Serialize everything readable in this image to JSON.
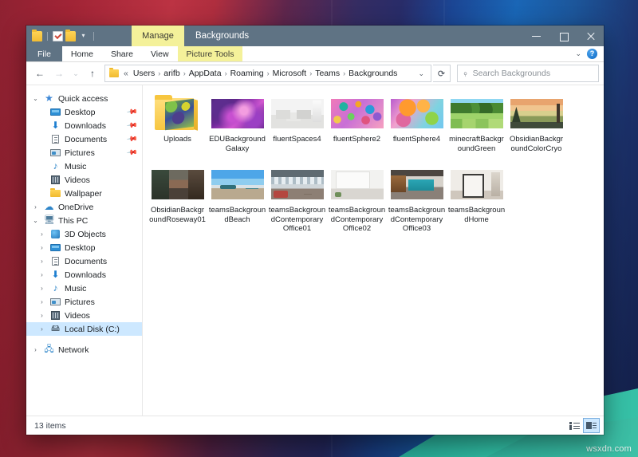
{
  "window": {
    "title": "Backgrounds",
    "contextual_tab_group": "Manage",
    "minimize_label": "Minimize",
    "maximize_label": "Maximize",
    "close_label": "Close"
  },
  "quick_access_toolbar": {
    "items": [
      {
        "name": "folder-icon",
        "label": "Properties Folder"
      },
      {
        "name": "properties-icon",
        "label": "Properties"
      },
      {
        "name": "new-folder-icon",
        "label": "New folder"
      }
    ],
    "customize_label": "Customize Quick Access Toolbar"
  },
  "ribbon": {
    "tabs": [
      {
        "label": "File",
        "kind": "file"
      },
      {
        "label": "Home",
        "kind": "normal"
      },
      {
        "label": "Share",
        "kind": "normal"
      },
      {
        "label": "View",
        "kind": "normal"
      },
      {
        "label": "Picture Tools",
        "kind": "contextual"
      }
    ],
    "collapse_label": "Collapse the Ribbon",
    "help_label": "?"
  },
  "address_bar": {
    "back_label": "Back",
    "forward_label": "Forward",
    "recent_label": "Recent locations",
    "up_label": "Up",
    "overflow": "«",
    "crumbs": [
      "Users",
      "arifb",
      "AppData",
      "Roaming",
      "Microsoft",
      "Teams",
      "Backgrounds"
    ],
    "separator": "›",
    "dropdown_label": "Previous locations",
    "refresh_label": "Refresh"
  },
  "search": {
    "placeholder": "Search Backgrounds",
    "icon": "search-icon"
  },
  "sidebar": {
    "items": [
      {
        "label": "Quick access",
        "icon": "star-icon",
        "twisty": "⌄",
        "indent": 0,
        "pinned": false,
        "selected": false
      },
      {
        "label": "Desktop",
        "icon": "desktop-icon",
        "twisty": "",
        "indent": 1,
        "pinned": true,
        "selected": false
      },
      {
        "label": "Downloads",
        "icon": "download-icon",
        "twisty": "",
        "indent": 1,
        "pinned": true,
        "selected": false
      },
      {
        "label": "Documents",
        "icon": "document-icon",
        "twisty": "",
        "indent": 1,
        "pinned": true,
        "selected": false
      },
      {
        "label": "Pictures",
        "icon": "pictures-icon",
        "twisty": "",
        "indent": 1,
        "pinned": true,
        "selected": false
      },
      {
        "label": "Music",
        "icon": "music-icon",
        "twisty": "",
        "indent": 1,
        "pinned": false,
        "selected": false
      },
      {
        "label": "Videos",
        "icon": "video-icon",
        "twisty": "",
        "indent": 1,
        "pinned": false,
        "selected": false
      },
      {
        "label": "Wallpaper",
        "icon": "folder-icon",
        "twisty": "",
        "indent": 1,
        "pinned": false,
        "selected": false
      },
      {
        "label": "OneDrive",
        "icon": "cloud-icon",
        "twisty": "›",
        "indent": 0,
        "pinned": false,
        "selected": false
      },
      {
        "label": "This PC",
        "icon": "pc-icon",
        "twisty": "⌄",
        "indent": 0,
        "pinned": false,
        "selected": false
      },
      {
        "label": "3D Objects",
        "icon": "cube-icon",
        "twisty": "›",
        "indent": 1,
        "pinned": false,
        "selected": false
      },
      {
        "label": "Desktop",
        "icon": "desktop-icon",
        "twisty": "›",
        "indent": 1,
        "pinned": false,
        "selected": false
      },
      {
        "label": "Documents",
        "icon": "document-icon",
        "twisty": "›",
        "indent": 1,
        "pinned": false,
        "selected": false
      },
      {
        "label": "Downloads",
        "icon": "download-icon",
        "twisty": "›",
        "indent": 1,
        "pinned": false,
        "selected": false
      },
      {
        "label": "Music",
        "icon": "music-icon",
        "twisty": "›",
        "indent": 1,
        "pinned": false,
        "selected": false
      },
      {
        "label": "Pictures",
        "icon": "pictures-icon",
        "twisty": "›",
        "indent": 1,
        "pinned": false,
        "selected": false
      },
      {
        "label": "Videos",
        "icon": "video-icon",
        "twisty": "›",
        "indent": 1,
        "pinned": false,
        "selected": false
      },
      {
        "label": "Local Disk (C:)",
        "icon": "disk-icon",
        "twisty": "›",
        "indent": 1,
        "pinned": false,
        "selected": true
      },
      {
        "label": "Network",
        "icon": "network-icon",
        "twisty": "›",
        "indent": 0,
        "pinned": false,
        "selected": false
      }
    ]
  },
  "files": [
    {
      "name": "Uploads",
      "thumb": "folder",
      "kind": "folder"
    },
    {
      "name": "EDUBackgroundGalaxy",
      "thumb": "galaxy",
      "kind": "image"
    },
    {
      "name": "fluentSpaces4",
      "thumb": "spaces",
      "kind": "image"
    },
    {
      "name": "fluentSphere2",
      "thumb": "sphere2",
      "kind": "image"
    },
    {
      "name": "fluentSphere4",
      "thumb": "sphere4",
      "kind": "image"
    },
    {
      "name": "minecraftBackgroundGreen",
      "thumb": "minecraft",
      "kind": "image"
    },
    {
      "name": "ObsidianBackgroundColorCryo",
      "thumb": "cryo",
      "kind": "image"
    },
    {
      "name": "ObsidianBackgroundRoseway01",
      "thumb": "roseway",
      "kind": "image"
    },
    {
      "name": "teamsBackgroundBeach",
      "thumb": "beach",
      "kind": "image"
    },
    {
      "name": "teamsBackgroundContemporaryOffice01",
      "thumb": "office1",
      "kind": "image"
    },
    {
      "name": "teamsBackgroundContemporaryOffice02",
      "thumb": "office2",
      "kind": "image"
    },
    {
      "name": "teamsBackgroundContemporaryOffice03",
      "thumb": "office3",
      "kind": "image"
    },
    {
      "name": "teamsBackgroundHome",
      "thumb": "home",
      "kind": "image"
    }
  ],
  "status_bar": {
    "item_count": "13 items",
    "details_view_label": "Details view",
    "large_icons_view_label": "Large icons view",
    "active_view": "large_icons"
  },
  "desktop": {
    "watermark": "wsxdn.com"
  },
  "colors": {
    "titlebar": "#5f7384",
    "contextual_tab": "#f4f19a",
    "selection": "#cde8ff",
    "accent_blue": "#0a66c2",
    "folder_yellow": "#f7c63f",
    "teal_shape": "#2fb89f"
  }
}
